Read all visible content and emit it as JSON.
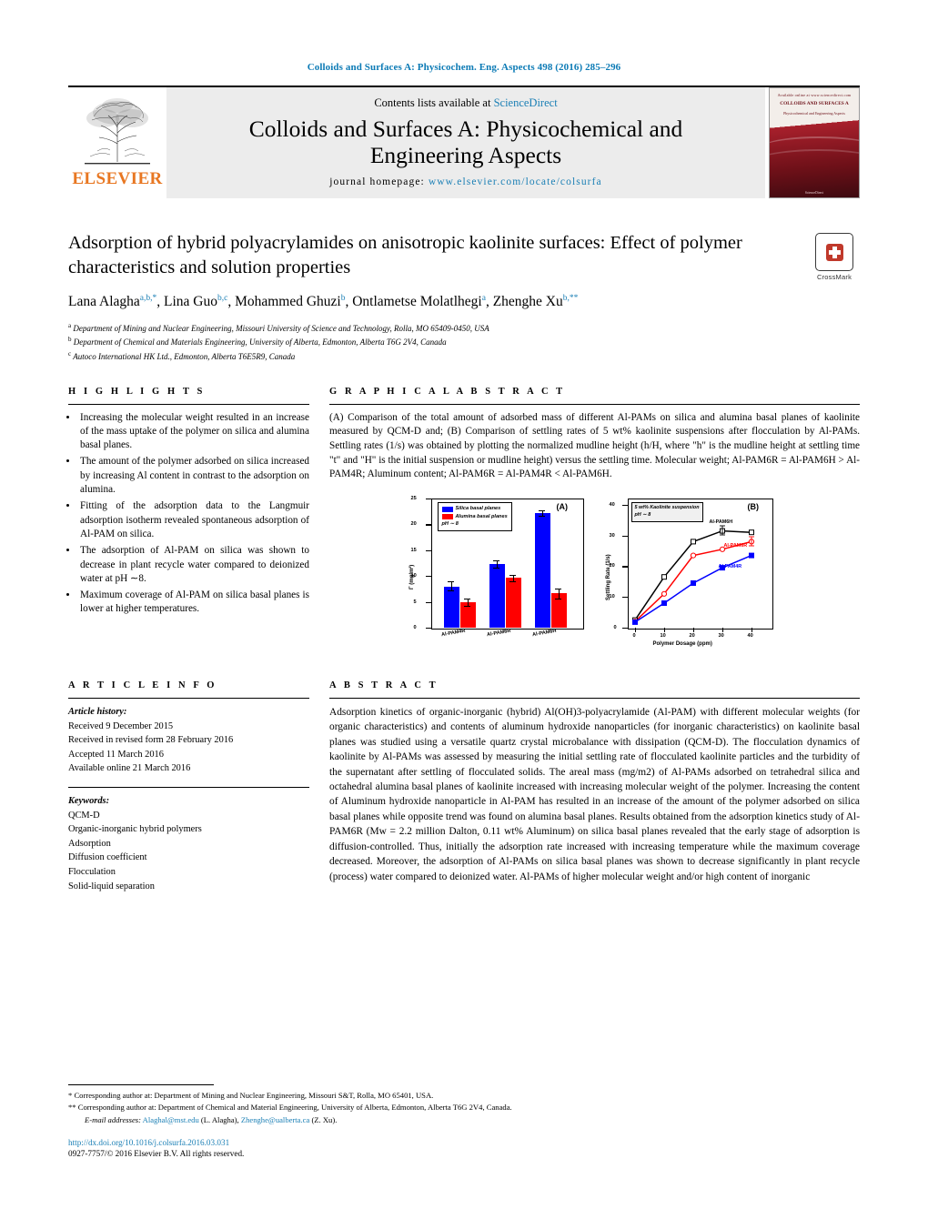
{
  "running_head": "Colloids and Surfaces A: Physicochem. Eng. Aspects 498 (2016) 285–296",
  "masthead": {
    "contents_prefix": "Contents lists available at ",
    "sciencedirect": "ScienceDirect",
    "journal_title_line1": "Colloids and Surfaces A: Physicochemical and",
    "journal_title_line2": "Engineering Aspects",
    "homepage_label": "journal homepage:",
    "homepage_url": "www.elsevier.com/locate/colsurfa",
    "publisher": "ELSEVIER",
    "cover": {
      "top_line": "Available online at www.sciencedirect.com",
      "title": "COLLOIDS AND SURFACES A",
      "sub": "Physicochemical and Engineering Aspects",
      "foot": "ScienceDirect"
    }
  },
  "article": {
    "title": "Adsorption of hybrid polyacrylamides on anisotropic kaolinite surfaces: Effect of polymer characteristics and solution properties",
    "crossmark_label": "CrossMark",
    "authors": [
      {
        "name": "Lana Alagha",
        "sup": "a,b,*"
      },
      {
        "name": "Lina Guo",
        "sup": "b,c"
      },
      {
        "name": "Mohammed Ghuzi",
        "sup": "b"
      },
      {
        "name": "Ontlametse Molatlhegi",
        "sup": "a"
      },
      {
        "name": "Zhenghe Xu",
        "sup": "b,**"
      }
    ],
    "affiliations": [
      {
        "mark": "a",
        "text": "Department of Mining and Nuclear Engineering, Missouri University of Science and Technology, Rolla, MO 65409-0450, USA"
      },
      {
        "mark": "b",
        "text": "Department of Chemical and Materials Engineering, University of Alberta, Edmonton, Alberta T6G 2V4, Canada"
      },
      {
        "mark": "c",
        "text": "Autoco International HK Ltd., Edmonton, Alberta T6E5R9, Canada"
      }
    ]
  },
  "highlights": {
    "heading": "H I G H L I G H T S",
    "items": [
      "Increasing the molecular weight resulted in an increase of the mass uptake of the polymer on silica and alumina basal planes.",
      "The amount of the polymer adsorbed on silica increased by increasing Al content in contrast to the adsorption on alumina.",
      "Fitting of the adsorption data to the Langmuir adsorption isotherm revealed spontaneous adsorption of Al-PAM on silica.",
      "The adsorption of Al-PAM on silica was shown to decrease in plant recycle water compared to deionized water at pH ∼8.",
      "Maximum coverage of Al-PAM on silica basal planes is lower at higher temperatures."
    ]
  },
  "graphical_abstract": {
    "heading": "G R A P H I C A L   A B S T R A C T",
    "caption": "(A) Comparison of the total amount of adsorbed mass of different Al-PAMs on silica and alumina basal planes of kaolinite measured by QCM-D and; (B) Comparison of settling rates of 5 wt% kaolinite suspensions after flocculation by Al-PAMs. Settling rates (1/s) was obtained by plotting the normalized mudline height (h/H, where \"h\" is the mudline height at settling time \"t\" and \"H\" is the initial suspension or mudline height) versus the settling time. Molecular weight; Al-PAM6R = Al-PAM6H > Al-PAM4R; Aluminum content; Al-PAM6R = Al-PAM4R < Al-PAM6H."
  },
  "chart_data": [
    {
      "type": "bar",
      "panel": "(A)",
      "title": "",
      "xlabel": "",
      "ylabel": "Γ (mg/m²)",
      "ylim": [
        0,
        25
      ],
      "yticks": [
        0,
        5,
        10,
        15,
        20,
        25
      ],
      "categories": [
        "Al-PAM4R",
        "Al-PAM6R",
        "Al-PAM6H"
      ],
      "legend_position": "top-left",
      "legend_note": "pH ∼ 8",
      "series": [
        {
          "name": "Silica basal planes",
          "color": "#0000ff",
          "values": [
            8.0,
            12.4,
            22.2
          ],
          "errors": [
            0.9,
            0.7,
            0.3
          ]
        },
        {
          "name": "Alumina basal planes",
          "color": "#ff0000",
          "values": [
            5.0,
            9.6,
            6.6
          ],
          "errors": [
            0.7,
            0.5,
            0.9
          ]
        }
      ]
    },
    {
      "type": "line",
      "panel": "(B)",
      "title": "",
      "xlabel": "Polymer Dosage (ppm)",
      "ylabel": "Settling Rate (1/s)",
      "xlim": [
        0,
        45
      ],
      "xticks": [
        0,
        10,
        20,
        30,
        40
      ],
      "ylim": [
        0,
        42
      ],
      "yticks": [
        0,
        10,
        20,
        30,
        40
      ],
      "note": "5 wt% Kaolinite suspension\npH ∼ 8",
      "x": [
        0,
        10,
        20,
        30,
        40
      ],
      "series": [
        {
          "name": "Al-PAM6H",
          "color": "#000000",
          "values": [
            2.5,
            16.5,
            28.0,
            31.5,
            31.0
          ]
        },
        {
          "name": "Al-PAM6R",
          "color": "#ff0000",
          "values": [
            2.0,
            11.0,
            23.5,
            25.5,
            28.0
          ]
        },
        {
          "name": "Al-PAM4R",
          "color": "#0000ff",
          "values": [
            1.8,
            8.0,
            14.5,
            19.5,
            23.5
          ]
        }
      ]
    }
  ],
  "article_info": {
    "heading": "A R T I C L E   I N F O",
    "history_label": "Article history:",
    "history": [
      "Received 9 December 2015",
      "Received in revised form 28 February 2016",
      "Accepted 11 March 2016",
      "Available online 21 March 2016"
    ],
    "keywords_label": "Keywords:",
    "keywords": [
      "QCM-D",
      "Organic-inorganic hybrid polymers",
      "Adsorption",
      "Diffusion coefficient",
      "Flocculation",
      "Solid-liquid separation"
    ]
  },
  "abstract": {
    "heading": "A B S T R A C T",
    "text": "Adsorption kinetics of organic-inorganic (hybrid) Al(OH)3-polyacrylamide (Al-PAM) with different molecular weights (for organic characteristics) and contents of aluminum hydroxide nanoparticles (for inorganic characteristics) on kaolinite basal planes was studied using a versatile quartz crystal microbalance with dissipation (QCM-D). The flocculation dynamics of kaolinite by Al-PAMs was assessed by measuring the initial settling rate of flocculated kaolinite particles and the turbidity of the supernatant after settling of flocculated solids. The areal mass (mg/m2) of Al-PAMs adsorbed on tetrahedral silica and octahedral alumina basal planes of kaolinite increased with increasing molecular weight of the polymer. Increasing the content of Aluminum hydroxide nanoparticle in Al-PAM has resulted in an increase of the amount of the polymer adsorbed on silica basal planes while opposite trend was found on alumina basal planes. Results obtained from the adsorption kinetics study of Al-PAM6R (Mw = 2.2 million Dalton, 0.11 wt% Aluminum) on silica basal planes revealed that the early stage of adsorption is diffusion-controlled. Thus, initially the adsorption rate increased with increasing temperature while the maximum coverage decreased. Moreover, the adsorption of Al-PAMs on silica basal planes was shown to decrease significantly in plant recycle (process) water compared to deionized water. Al-PAMs of higher molecular weight and/or high content of inorganic"
  },
  "footnotes": {
    "corresponding1": "* Corresponding author at: Department of Mining and Nuclear Engineering, Missouri S&T, Rolla, MO 65401, USA.",
    "corresponding2": "** Corresponding author at: Department of Chemical and Material Engineering, University of Alberta, Edmonton, Alberta T6G 2V4, Canada.",
    "email_label": "E-mail addresses:",
    "email1": "Alaghal@mst.edu",
    "email1_owner": "(L. Alagha),",
    "email2": "Zhenghe@ualberta.ca",
    "email2_owner": "(Z. Xu).",
    "doi": "http://dx.doi.org/10.1016/j.colsurfa.2016.03.031",
    "issn": "0927-7757/© 2016 Elsevier B.V. All rights reserved."
  }
}
